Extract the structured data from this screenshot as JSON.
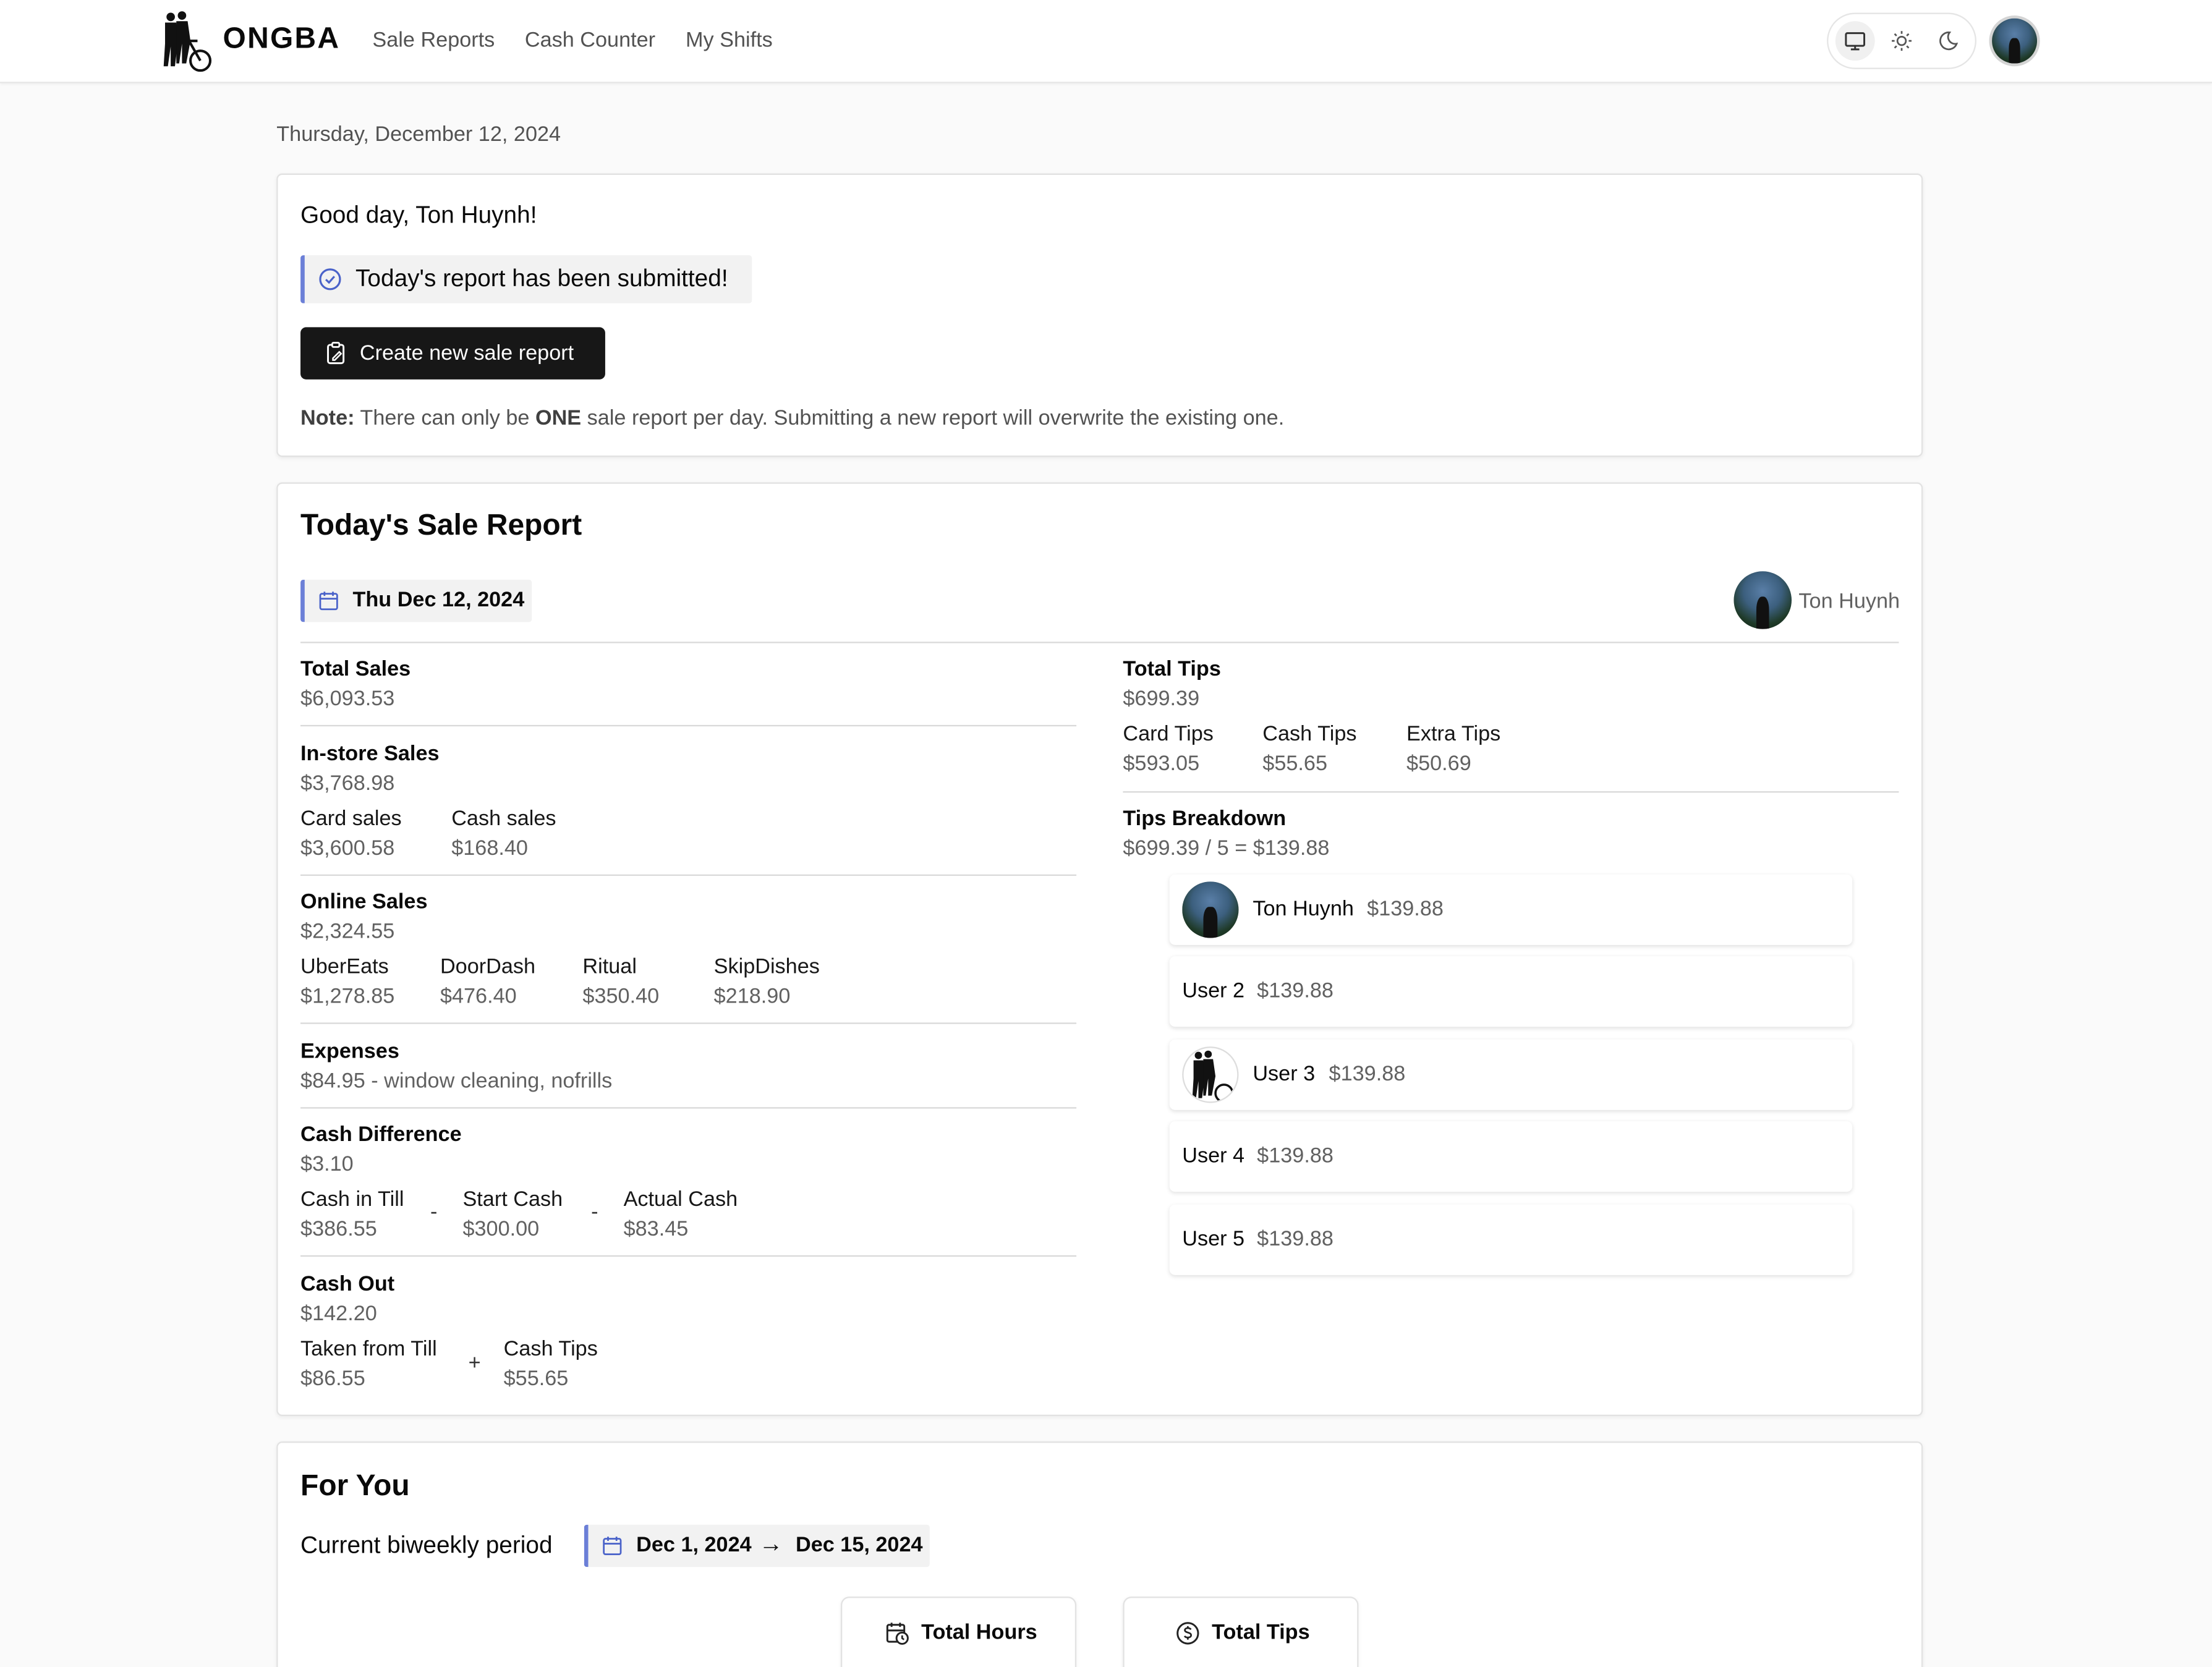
{
  "header": {
    "brand": "ONGBA",
    "nav": [
      "Sale Reports",
      "Cash Counter",
      "My Shifts"
    ]
  },
  "page": {
    "date": "Thursday, December 12, 2024"
  },
  "welcome": {
    "greeting": "Good day, Ton Huynh!",
    "alert": "Today's report has been submitted!",
    "create_button": "Create new sale report",
    "note_label": "Note:",
    "note_part1": "There can only be",
    "note_emph": "ONE",
    "note_part2": "sale report per day. Submitting a new report will overwrite the existing one."
  },
  "report": {
    "title": "Today's Sale Report",
    "date": "Thu Dec 12, 2024",
    "author": "Ton Huynh",
    "total_sales": {
      "label": "Total Sales",
      "value": "$6,093.53"
    },
    "instore": {
      "label": "In-store Sales",
      "value": "$3,768.98",
      "card_label": "Card sales",
      "card_value": "$3,600.58",
      "cash_label": "Cash sales",
      "cash_value": "$168.40"
    },
    "online": {
      "label": "Online Sales",
      "value": "$2,324.55",
      "items": [
        {
          "label": "UberEats",
          "value": "$1,278.85"
        },
        {
          "label": "DoorDash",
          "value": "$476.40"
        },
        {
          "label": "Ritual",
          "value": "$350.40"
        },
        {
          "label": "SkipDishes",
          "value": "$218.90"
        }
      ]
    },
    "expenses": {
      "label": "Expenses",
      "value": "$84.95 - window cleaning, nofrills"
    },
    "cash_diff": {
      "label": "Cash Difference",
      "value": "$3.10",
      "till_label": "Cash in Till",
      "till_value": "$386.55",
      "start_label": "Start Cash",
      "start_value": "$300.00",
      "actual_label": "Actual Cash",
      "actual_value": "$83.45",
      "op1": "-",
      "op2": "-"
    },
    "cash_out": {
      "label": "Cash Out",
      "value": "$142.20",
      "taken_label": "Taken from Till",
      "taken_value": "$86.55",
      "tips_label": "Cash Tips",
      "tips_value": "$55.65",
      "op": "+"
    },
    "total_tips": {
      "label": "Total Tips",
      "value": "$699.39",
      "card_label": "Card Tips",
      "card_value": "$593.05",
      "cash_label": "Cash Tips",
      "cash_value": "$55.65",
      "extra_label": "Extra Tips",
      "extra_value": "$50.69"
    },
    "breakdown": {
      "label": "Tips Breakdown",
      "formula": "$699.39 / 5 = $139.88",
      "people": [
        {
          "name": "Ton Huynh",
          "amount": "$139.88"
        },
        {
          "name": "User 2",
          "amount": "$139.88"
        },
        {
          "name": "User 3",
          "amount": "$139.88"
        },
        {
          "name": "User 4",
          "amount": "$139.88"
        },
        {
          "name": "User 5",
          "amount": "$139.88"
        }
      ]
    }
  },
  "for_you": {
    "title": "For You",
    "period_label": "Current biweekly period",
    "start": "Dec 1, 2024",
    "arrow": "→",
    "end": "Dec 15, 2024",
    "hours_title": "Total Hours",
    "tips_title": "Total Tips"
  }
}
